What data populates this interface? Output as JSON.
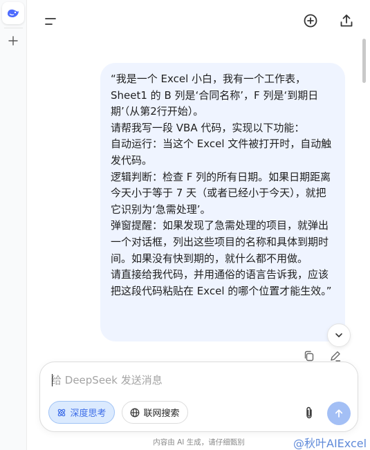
{
  "header": {
    "menu_icon": "sidebar-toggle-icon",
    "new_chat_icon": "new-chat-plus-circle-icon",
    "share_icon": "share-upload-icon"
  },
  "sidebar": {
    "logo_icon": "deepseek-whale-logo",
    "new_icon": "plus-icon"
  },
  "message": {
    "lines": [
      "“我是一个 Excel 小白，我有一个工作表，Sheet1 的 B 列是‘合同名称’，F 列是‘到期日期’（从第2行开始）。",
      "请帮我写一段 VBA 代码，实现以下功能：",
      "自动运行：当这个 Excel 文件被打开时，自动触发代码。",
      "逻辑判断：检查 F 列的所有日期。如果日期距离今天小于等于 7 天（或者已经小于今天），就把它识别为‘急需处理’。",
      "弹窗提醒：如果发现了急需处理的项目，就弹出一个对话框，列出这些项目的名称和具体到期时间。如果没有快到期的，就什么都不用做。",
      "请直接给我代码，并用通俗的语言告诉我，应该把这段代码粘贴在 Excel 的哪个位置才能生效。”"
    ],
    "actions": {
      "copy_icon": "copy-icon",
      "edit_icon": "edit-pencil-icon"
    }
  },
  "composer": {
    "placeholder": "给 DeepSeek 发送消息",
    "think_label": "深度思考",
    "search_label": "联网搜索",
    "attach_icon": "paperclip-icon",
    "send_icon": "arrow-up-icon"
  },
  "footer": {
    "note": "内容由 AI 生成，请仔细甄别",
    "watermark": "@秋叶AIExcel"
  },
  "colors": {
    "accent": "#4d6bfe",
    "bubble_bg": "#eff4ff",
    "think_bg": "#dbeafe",
    "send_bg": "#a3bff5"
  }
}
